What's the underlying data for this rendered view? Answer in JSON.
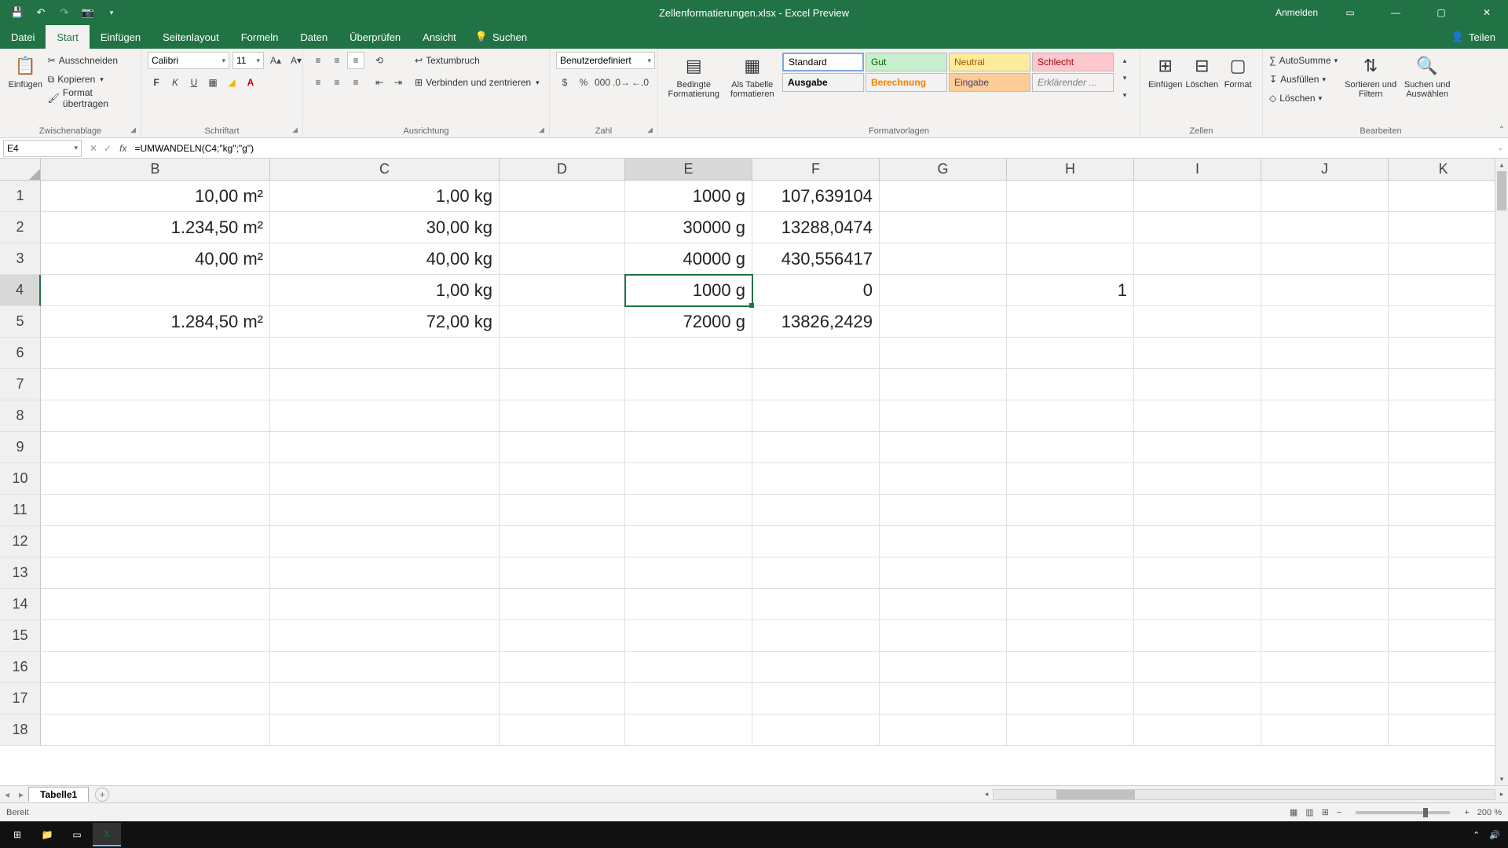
{
  "titlebar": {
    "doc_title": "Zellenformatierungen.xlsx - Excel Preview",
    "sign_in": "Anmelden"
  },
  "tabs": {
    "file": "Datei",
    "home": "Start",
    "insert": "Einfügen",
    "layout": "Seitenlayout",
    "formulas": "Formeln",
    "data": "Daten",
    "review": "Überprüfen",
    "view": "Ansicht",
    "search": "Suchen",
    "share": "Teilen"
  },
  "ribbon": {
    "clipboard": {
      "paste": "Einfügen",
      "cut": "Ausschneiden",
      "copy": "Kopieren",
      "format_painter": "Format übertragen",
      "label": "Zwischenablage"
    },
    "font": {
      "name": "Calibri",
      "size": "11",
      "label": "Schriftart"
    },
    "align": {
      "wrap": "Textumbruch",
      "merge": "Verbinden und zentrieren",
      "label": "Ausrichtung"
    },
    "number": {
      "format": "Benutzerdefiniert",
      "label": "Zahl"
    },
    "styles": {
      "cond": "Bedingte Formatierung",
      "table": "Als Tabelle formatieren",
      "standard": "Standard",
      "good": "Gut",
      "neutral": "Neutral",
      "bad": "Schlecht",
      "output": "Ausgabe",
      "calc": "Berechnung",
      "input": "Eingabe",
      "explain": "Erklärender ...",
      "label": "Formatvorlagen"
    },
    "cells": {
      "insert": "Einfügen",
      "delete": "Löschen",
      "format": "Format",
      "label": "Zellen"
    },
    "editing": {
      "autosum": "AutoSumme",
      "fill": "Ausfüllen",
      "clear": "Löschen",
      "sort": "Sortieren und Filtern",
      "find": "Suchen und Auswählen",
      "label": "Bearbeiten"
    }
  },
  "formula_bar": {
    "cell_ref": "E4",
    "formula": "=UMWANDELN(C4;\"kg\";\"g\")"
  },
  "grid": {
    "columns": [
      "B",
      "C",
      "D",
      "E",
      "F",
      "G",
      "H",
      "I",
      "J",
      "K"
    ],
    "selected_col": "E",
    "selected_row": 4,
    "rows": [
      1,
      2,
      3,
      4,
      5,
      6,
      7,
      8,
      9,
      10,
      11,
      12,
      13,
      14,
      15,
      16,
      17,
      18
    ],
    "data": {
      "1": {
        "B": "10,00 m²",
        "C": "1,00 kg",
        "E": "1000 g",
        "F": "107,639104"
      },
      "2": {
        "B": "1.234,50 m²",
        "C": "30,00 kg",
        "E": "30000 g",
        "F": "13288,0474"
      },
      "3": {
        "B": "40,00 m²",
        "C": "40,00 kg",
        "E": "40000 g",
        "F": "430,556417"
      },
      "4": {
        "C": "1,00 kg",
        "E": "1000 g",
        "F": "0",
        "H": "1"
      },
      "5": {
        "B": "1.284,50 m²",
        "C": "72,00 kg",
        "E": "72000 g",
        "F": "13826,2429"
      }
    }
  },
  "sheet_tabs": {
    "active": "Tabelle1"
  },
  "status": {
    "ready": "Bereit",
    "zoom": "200 %"
  },
  "chart_data": {
    "type": "table",
    "columns": [
      "B",
      "C",
      "D",
      "E",
      "F",
      "G",
      "H"
    ],
    "rows": [
      {
        "B": "10,00 m²",
        "C": "1,00 kg",
        "D": "",
        "E": "1000 g",
        "F": "107,639104",
        "G": "",
        "H": ""
      },
      {
        "B": "1.234,50 m²",
        "C": "30,00 kg",
        "D": "",
        "E": "30000 g",
        "F": "13288,0474",
        "G": "",
        "H": ""
      },
      {
        "B": "40,00 m²",
        "C": "40,00 kg",
        "D": "",
        "E": "40000 g",
        "F": "430,556417",
        "G": "",
        "H": ""
      },
      {
        "B": "",
        "C": "1,00 kg",
        "D": "",
        "E": "1000 g",
        "F": "0",
        "G": "",
        "H": "1"
      },
      {
        "B": "1.284,50 m²",
        "C": "72,00 kg",
        "D": "",
        "E": "72000 g",
        "F": "13826,2429",
        "G": "",
        "H": ""
      }
    ]
  }
}
